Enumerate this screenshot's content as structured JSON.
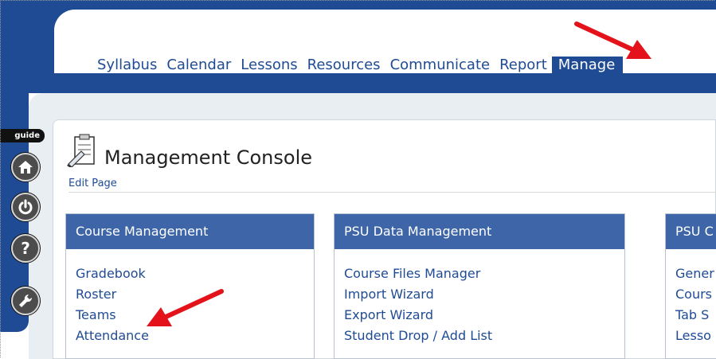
{
  "nav": {
    "tabs": [
      {
        "label": "Syllabus"
      },
      {
        "label": "Calendar"
      },
      {
        "label": "Lessons"
      },
      {
        "label": "Resources"
      },
      {
        "label": "Communicate"
      },
      {
        "label": "Report"
      },
      {
        "label": "Manage"
      }
    ],
    "active": "Manage"
  },
  "left_rail": {
    "guide_label": "guide",
    "icons": [
      "home-icon",
      "power-icon",
      "help-icon",
      "wrench-icon"
    ]
  },
  "header": {
    "title": "Management Console",
    "edit_label": "Edit Page"
  },
  "panels": [
    {
      "title": "Course Management",
      "items": [
        "Gradebook",
        "Roster",
        "Teams",
        "Attendance"
      ]
    },
    {
      "title": "PSU Data Management",
      "items": [
        "Course Files Manager",
        "Import Wizard",
        "Export Wizard",
        "Student Drop / Add List"
      ]
    },
    {
      "title": "PSU C",
      "items": [
        "Gener",
        "Cours",
        "Tab S",
        "Lesso"
      ]
    }
  ],
  "colors": {
    "brand_blue": "#1f4b95",
    "panel_header": "#3d65a8",
    "arrow_red": "#e4131b"
  }
}
